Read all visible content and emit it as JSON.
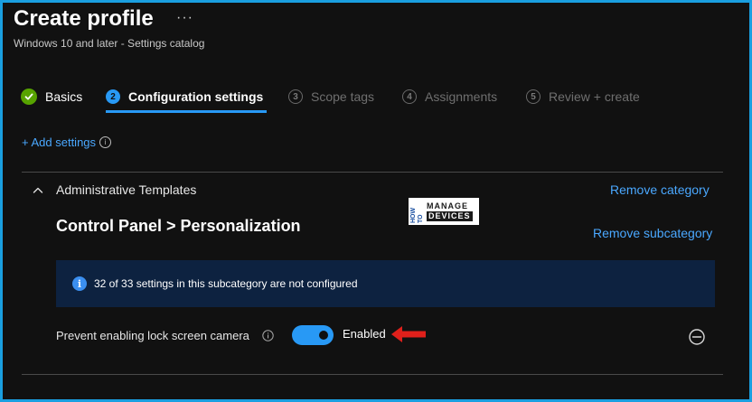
{
  "header": {
    "title": "Create profile",
    "more_label": "···",
    "subtitle": "Windows 10 and later - Settings catalog"
  },
  "wizard": {
    "steps": [
      {
        "index": "",
        "label": "Basics",
        "state": "done"
      },
      {
        "index": "2",
        "label": "Configuration settings",
        "state": "current"
      },
      {
        "index": "3",
        "label": "Scope tags",
        "state": "pending"
      },
      {
        "index": "4",
        "label": "Assignments",
        "state": "pending"
      },
      {
        "index": "5",
        "label": "Review + create",
        "state": "pending"
      }
    ]
  },
  "add_settings": {
    "label": "+ Add settings",
    "info": "i"
  },
  "category": {
    "label": "Administrative Templates",
    "remove_label": "Remove category"
  },
  "subcategory": {
    "title": "Control Panel > Personalization",
    "remove_label": "Remove subcategory"
  },
  "watermark": {
    "how_to": "HOW TO",
    "manage": "MANAGE",
    "devices": "DEVICES"
  },
  "banner": {
    "icon": "i",
    "text": "32 of 33 settings in this subcategory are not configured"
  },
  "setting": {
    "label": "Prevent enabling lock screen camera",
    "info": "i",
    "state_label": "Enabled",
    "enabled": true
  },
  "colors": {
    "accent": "#2899f5",
    "link": "#4aa8ff",
    "success": "#57a300",
    "frame": "#1a9fe0",
    "annotation_arrow": "#e0201b",
    "banner_bg": "#0d2240"
  },
  "icons": {
    "done_step": "check-icon",
    "collapse": "chevron-up-icon",
    "remove_setting": "minus-circle-icon",
    "annotation": "left-arrow-icon"
  }
}
